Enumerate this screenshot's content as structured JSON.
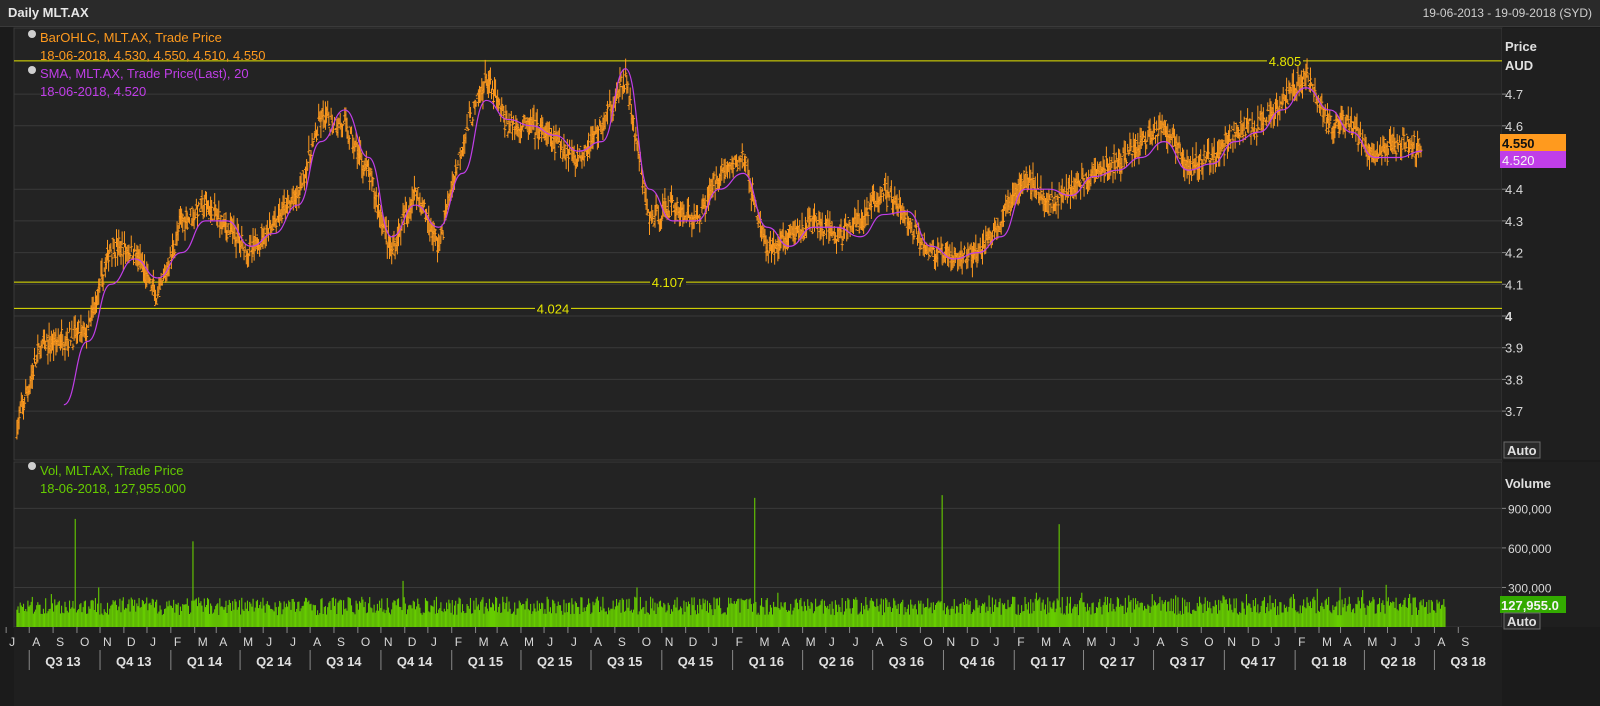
{
  "window": {
    "title": "Daily MLT.AX",
    "date_range": "19-06-2013 - 19-09-2018 (SYD)"
  },
  "colors": {
    "background": "#1b1b1b",
    "plot_background": "#232323",
    "grid": "#3a3a3a",
    "price_bars": "#ff9a1e",
    "sma": "#c03ee8",
    "volume": "#66cc00",
    "levels": "#e6e600"
  },
  "legend": {
    "ohlc_title": "BarOHLC, MLT.AX, Trade Price",
    "ohlc_values": "18-06-2018, 4.530, 4.550, 4.510, 4.550",
    "sma_title": "SMA, MLT.AX, Trade Price(Last),  20",
    "sma_values": "18-06-2018, 4.520",
    "vol_title": "Vol, MLT.AX, Trade Price",
    "vol_values": "18-06-2018, 127,955.000"
  },
  "price_axis": {
    "label": "Price",
    "currency": "AUD",
    "ticks": [
      "4.7",
      "4.6",
      "4.4",
      "4.3",
      "4.2",
      "4.1",
      "4",
      "3.9",
      "3.8",
      "3.7"
    ],
    "tick_values": [
      4.7,
      4.6,
      4.4,
      4.3,
      4.2,
      4.1,
      4.0,
      3.9,
      3.8,
      3.7
    ],
    "last_price": "4.550",
    "last_sma": "4.520",
    "auto_label": "Auto"
  },
  "volume_axis": {
    "label": "Volume",
    "ticks": [
      "900,000",
      "600,000",
      "300,000"
    ],
    "tick_values": [
      900000,
      600000,
      300000
    ],
    "last_volume": "127,955.0",
    "auto_label": "Auto"
  },
  "time_axis": {
    "months": [
      "J",
      "A",
      "S",
      "O",
      "N",
      "D",
      "J",
      "F",
      "M",
      "A",
      "M",
      "J",
      "J",
      "A",
      "S",
      "O",
      "N",
      "D",
      "J",
      "F",
      "M",
      "A",
      "M",
      "J",
      "J",
      "A",
      "S",
      "O",
      "N",
      "D",
      "J",
      "F",
      "M",
      "A",
      "M",
      "J",
      "J",
      "A",
      "S",
      "O",
      "N",
      "D",
      "J",
      "F",
      "M",
      "A",
      "M",
      "J",
      "J",
      "A",
      "S",
      "O",
      "N",
      "D",
      "J",
      "F",
      "M",
      "A",
      "M",
      "J",
      "J",
      "A",
      "S"
    ],
    "quarters": [
      "Q3 13",
      "Q4 13",
      "Q1 14",
      "Q2 14",
      "Q3 14",
      "Q4 14",
      "Q1 15",
      "Q2 15",
      "Q3 15",
      "Q4 15",
      "Q1 16",
      "Q2 16",
      "Q3 16",
      "Q4 16",
      "Q1 17",
      "Q2 17",
      "Q3 17",
      "Q4 17",
      "Q1 18",
      "Q2 18",
      "Q3 18"
    ]
  },
  "chart_data": {
    "type": "line",
    "title": "Daily MLT.AX",
    "x_range": [
      "2013-06-19",
      "2018-09-19"
    ],
    "y_range": [
      3.6,
      4.85
    ],
    "y_scale": "linear",
    "grid": true,
    "series": [
      {
        "name": "BarOHLC, MLT.AX, Trade Price",
        "style": "ohlc-bars",
        "x": [
          "2013-06",
          "2013-07",
          "2013-08",
          "2013-09",
          "2013-10",
          "2013-11",
          "2013-12",
          "2014-01",
          "2014-02",
          "2014-03",
          "2014-04",
          "2014-05",
          "2014-06",
          "2014-07",
          "2014-08",
          "2014-09",
          "2014-10",
          "2014-11",
          "2014-12",
          "2015-01",
          "2015-02",
          "2015-03",
          "2015-04",
          "2015-05",
          "2015-06",
          "2015-07",
          "2015-08",
          "2015-09",
          "2015-10",
          "2015-11",
          "2015-12",
          "2016-01",
          "2016-02",
          "2016-03",
          "2016-04",
          "2016-05",
          "2016-06",
          "2016-07",
          "2016-08",
          "2016-09",
          "2016-10",
          "2016-11",
          "2016-12",
          "2017-01",
          "2017-02",
          "2017-03",
          "2017-04",
          "2017-05",
          "2017-06",
          "2017-07",
          "2017-08",
          "2017-09",
          "2017-10",
          "2017-11",
          "2017-12",
          "2018-01",
          "2018-02",
          "2018-03",
          "2018-04",
          "2018-05",
          "2018-06"
        ],
        "y": [
          3.65,
          3.9,
          3.93,
          3.95,
          4.22,
          4.2,
          4.05,
          4.3,
          4.35,
          4.28,
          4.2,
          4.3,
          4.38,
          4.62,
          4.6,
          4.45,
          4.2,
          4.4,
          4.22,
          4.55,
          4.75,
          4.6,
          4.6,
          4.55,
          4.5,
          4.6,
          4.75,
          4.3,
          4.35,
          4.3,
          4.45,
          4.5,
          4.2,
          4.25,
          4.3,
          4.25,
          4.3,
          4.4,
          4.3,
          4.2,
          4.18,
          4.2,
          4.3,
          4.45,
          4.35,
          4.4,
          4.45,
          4.48,
          4.55,
          4.6,
          4.47,
          4.5,
          4.58,
          4.6,
          4.68,
          4.76,
          4.6,
          4.6,
          4.5,
          4.55,
          4.53
        ]
      },
      {
        "name": "SMA, MLT.AX, Trade Price(Last),  20",
        "x": [
          "2013-08",
          "2013-09",
          "2013-10",
          "2013-11",
          "2013-12",
          "2014-01",
          "2014-02",
          "2014-03",
          "2014-04",
          "2014-05",
          "2014-06",
          "2014-07",
          "2014-08",
          "2014-09",
          "2014-10",
          "2014-11",
          "2014-12",
          "2015-01",
          "2015-02",
          "2015-03",
          "2015-04",
          "2015-05",
          "2015-06",
          "2015-07",
          "2015-08",
          "2015-09",
          "2015-10",
          "2015-11",
          "2015-12",
          "2016-01",
          "2016-02",
          "2016-03",
          "2016-04",
          "2016-05",
          "2016-06",
          "2016-07",
          "2016-08",
          "2016-09",
          "2016-10",
          "2016-11",
          "2016-12",
          "2017-01",
          "2017-02",
          "2017-03",
          "2017-04",
          "2017-05",
          "2017-06",
          "2017-07",
          "2017-08",
          "2017-09",
          "2017-10",
          "2017-11",
          "2017-12",
          "2018-01",
          "2018-02",
          "2018-03",
          "2018-04",
          "2018-05",
          "2018-06"
        ],
        "y": [
          3.72,
          3.92,
          4.1,
          4.18,
          4.12,
          4.2,
          4.3,
          4.3,
          4.22,
          4.26,
          4.35,
          4.55,
          4.65,
          4.5,
          4.25,
          4.35,
          4.28,
          4.45,
          4.68,
          4.62,
          4.6,
          4.57,
          4.52,
          4.55,
          4.78,
          4.4,
          4.3,
          4.3,
          4.4,
          4.45,
          4.28,
          4.22,
          4.28,
          4.28,
          4.25,
          4.32,
          4.33,
          4.22,
          4.18,
          4.2,
          4.25,
          4.4,
          4.4,
          4.38,
          4.44,
          4.46,
          4.5,
          4.55,
          4.46,
          4.48,
          4.55,
          4.58,
          4.65,
          4.72,
          4.65,
          4.58,
          4.5,
          4.5,
          4.52
        ]
      },
      {
        "name": "Vol, MLT.AX, Trade Price",
        "style": "volume-bars",
        "x": [
          "2013-06",
          "2013-07",
          "2013-08",
          "2013-09",
          "2013-10",
          "2013-11",
          "2013-12",
          "2014-01",
          "2014-02",
          "2014-03",
          "2014-04",
          "2014-05",
          "2014-06",
          "2014-07",
          "2014-08",
          "2014-09",
          "2014-10",
          "2014-11",
          "2014-12",
          "2015-01",
          "2015-02",
          "2015-03",
          "2015-04",
          "2015-05",
          "2015-06",
          "2015-07",
          "2015-08",
          "2015-09",
          "2015-10",
          "2015-11",
          "2015-12",
          "2016-01",
          "2016-02",
          "2016-03",
          "2016-04",
          "2016-05",
          "2016-06",
          "2016-07",
          "2016-08",
          "2016-09",
          "2016-10",
          "2016-11",
          "2016-12",
          "2017-01",
          "2017-02",
          "2017-03",
          "2017-04",
          "2017-05",
          "2017-06",
          "2017-07",
          "2017-08",
          "2017-09",
          "2017-10",
          "2017-11",
          "2017-12",
          "2018-01",
          "2018-02",
          "2018-03",
          "2018-04",
          "2018-05",
          "2018-06"
        ],
        "y": [
          200000,
          250000,
          820000,
          300000,
          200000,
          180000,
          200000,
          650000,
          160000,
          150000,
          140000,
          150000,
          200000,
          220000,
          200000,
          200000,
          350000,
          200000,
          180000,
          200000,
          220000,
          200000,
          180000,
          180000,
          180000,
          200000,
          300000,
          200000,
          200000,
          200000,
          220000,
          980000,
          260000,
          220000,
          200000,
          220000,
          220000,
          200000,
          200000,
          1000000,
          220000,
          240000,
          230000,
          260000,
          780000,
          260000,
          230000,
          240000,
          250000,
          240000,
          230000,
          240000,
          250000,
          240000,
          250000,
          290000,
          300000,
          280000,
          320000,
          250000,
          127955
        ]
      }
    ],
    "reference_lines": [
      {
        "label": "4.805",
        "value": 4.805
      },
      {
        "label": "4.107",
        "value": 4.107
      },
      {
        "label": "4.024",
        "value": 4.024
      }
    ]
  }
}
